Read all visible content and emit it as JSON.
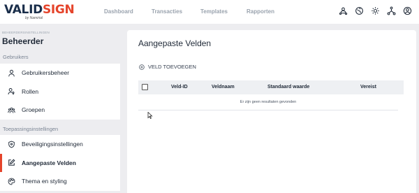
{
  "brand": {
    "name_part1": "VALID",
    "name_part2": "SIGN",
    "tagline": "by Namirial"
  },
  "top_nav": [
    "Dashboard",
    "Transacties",
    "Templates",
    "Rapporten"
  ],
  "top_icons": [
    "users-network-icon",
    "globe-icon",
    "sun-icon",
    "hierarchy-icon",
    "account-icon"
  ],
  "sidebar": {
    "breadcrumb": "BEHEERDERSINSTELLINGEN",
    "title": "Beheerder",
    "sections": [
      {
        "label": "Gebruikers",
        "items": [
          {
            "label": "Gebruikersbeheer",
            "icon": "user-icon"
          },
          {
            "label": "Rollen",
            "icon": "user-key-icon"
          },
          {
            "label": "Groepen",
            "icon": "group-icon"
          }
        ]
      },
      {
        "label": "Toepassingsinstellingen",
        "items": [
          {
            "label": "Beveiligingsinstellingen",
            "icon": "shield-icon"
          },
          {
            "label": "Aangepaste Velden",
            "icon": "edit-icon",
            "active": true
          },
          {
            "label": "Thema en styling",
            "icon": "palette-icon"
          }
        ]
      }
    ]
  },
  "main": {
    "title": "Aangepaste Velden",
    "add_button": "VELD TOEVOEGEN",
    "table": {
      "columns": [
        "Veld-ID",
        "Veldnaam",
        "Standaard waarde",
        "Vereist"
      ],
      "empty_message": "Er zijn geen resultaten gevonden"
    }
  },
  "colors": {
    "accent": "#e5442b",
    "brand_dark": "#1a2e4a",
    "background": "#ededf0"
  }
}
